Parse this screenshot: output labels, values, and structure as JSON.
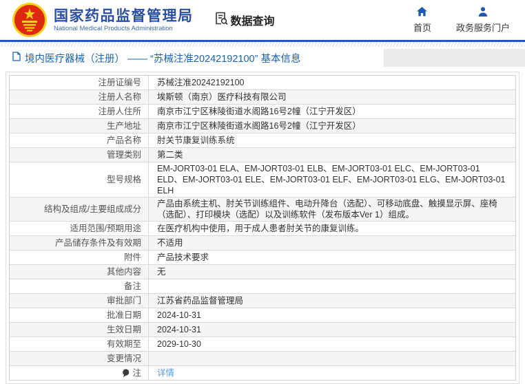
{
  "header": {
    "agency_name_cn": "国家药品监督管理局",
    "agency_name_en": "National Medical Products Administration",
    "data_query_label": "数据查询",
    "nav": [
      {
        "label": "首页",
        "icon": "home-icon"
      },
      {
        "label": "政务服务门户",
        "icon": "person-icon"
      }
    ]
  },
  "breadcrumb": {
    "text": "境内医疗器械（注册） —— “苏械注准20242192100” 基本信息"
  },
  "table": {
    "rows": [
      {
        "label": "注册证编号",
        "value": "苏械注准20242192100"
      },
      {
        "label": "注册人名称",
        "value": "埃斯顿（南京）医疗科技有限公司"
      },
      {
        "label": "注册人住所",
        "value": "南京市江宁区秣陵街道水阁路16号2幢（江宁开发区）"
      },
      {
        "label": "生产地址",
        "value": "南京市江宁区秣陵街道水阁路16号2幢（江宁开发区）"
      },
      {
        "label": "产品名称",
        "value": "肘关节康复训练系统"
      },
      {
        "label": "管理类别",
        "value": "第二类"
      },
      {
        "label": "型号规格",
        "value": "EM-JORT03-01 ELA、EM-JORT03-01 ELB、EM-JORT03-01 ELC、EM-JORT03-01 ELD、EM-JORT03-01 ELE、EM-JORT03-01 ELF、EM-JORT03-01 ELG、EM-JORT03-01 ELH"
      },
      {
        "label": "结构及组成/主要组成成分",
        "value": "产品由系统主机、肘关节训练组件、电动升降台（选配）、可移动底盘、触摸显示屏、座椅（选配）、打印模块（选配）以及训练软件（发布版本Ver 1）组成。"
      },
      {
        "label": "适用范围/预期用途",
        "value": "在医疗机构中使用，用于成人患者肘关节的康复训练。"
      },
      {
        "label": "产品储存条件及有效期",
        "value": "不适用"
      },
      {
        "label": "附件",
        "value": "产品技术要求"
      },
      {
        "label": "其他内容",
        "value": "无"
      },
      {
        "label": "备注",
        "value": ""
      },
      {
        "label": "审批部门",
        "value": "江苏省药品监督管理局"
      },
      {
        "label": "批准日期",
        "value": "2024-10-31"
      },
      {
        "label": "生效日期",
        "value": "2024-10-31"
      },
      {
        "label": "有效期至",
        "value": "2029-10-30"
      },
      {
        "label": "变更情况",
        "value": ""
      },
      {
        "label": "注",
        "value": "详情",
        "link": true,
        "icon": "note-balloon-icon"
      }
    ]
  },
  "colors": {
    "accent_blue": "#2a4f9e",
    "line_blue": "#1a5cae",
    "nav_blue": "#1e5bb0",
    "breadcrumb_blue": "#1a64ae",
    "link_blue": "#4f9cea",
    "emblem_red": "#de2910",
    "emblem_gold": "#f7d117",
    "alt_row_bg": "#f5f5f5",
    "bar_bg": "#ebebeb"
  }
}
